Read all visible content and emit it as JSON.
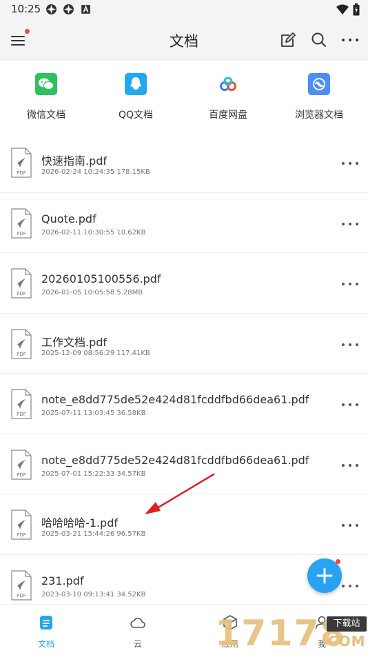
{
  "status_bar": {
    "time": "10:25"
  },
  "app_bar": {
    "title": "文档"
  },
  "sources": [
    {
      "label": "微信文档",
      "icon": "wechat-icon",
      "color": "#2dc15f"
    },
    {
      "label": "QQ文档",
      "icon": "qq-icon",
      "color": "#21a8f5"
    },
    {
      "label": "百度网盘",
      "icon": "baidu-netdisk-icon",
      "color": "#3b7df5"
    },
    {
      "label": "浏览器文档",
      "icon": "browser-icon",
      "color": "#4b8ef5"
    }
  ],
  "files": [
    {
      "name": "快速指南.pdf",
      "meta": "2026-02-24 10:24:35 178.15KB"
    },
    {
      "name": "Quote.pdf",
      "meta": "2026-02-11 10:30:55 10.62KB"
    },
    {
      "name": "20260105100556.pdf",
      "meta": "2026-01-05 10:05:58 5.28MB"
    },
    {
      "name": "工作文档.pdf",
      "meta": "2025-12-09 08:56:29 117.41KB"
    },
    {
      "name": "note_e8dd775de52e424d81fcddfbd66dea61.pdf",
      "meta": "2025-07-11 13:03:45 36.58KB"
    },
    {
      "name": "note_e8dd775de52e424d81fcddfbd66dea61.pdf",
      "meta": "2025-07-01 15:22:33 34.57KB"
    },
    {
      "name": "哈哈哈哈-1.pdf",
      "meta": "2025-03-21 15:44:26 96.57KB"
    },
    {
      "name": "231.pdf",
      "meta": "2023-03-10 09:13:41 34.52KB"
    }
  ],
  "file_icon_label": "PDF",
  "bottom_nav": [
    {
      "label": "文档",
      "icon": "document-icon",
      "active": true
    },
    {
      "label": "云",
      "icon": "cloud-icon",
      "active": false
    },
    {
      "label": "应用",
      "icon": "apps-icon",
      "active": false
    },
    {
      "label": "我",
      "icon": "profile-icon",
      "active": false
    }
  ],
  "watermark": {
    "digits": "17178",
    "box": "下载站",
    "suffix": "COM"
  },
  "colors": {
    "accent": "#2aa2f2",
    "badge": "#f24a3a",
    "arrow": "#e02020"
  }
}
